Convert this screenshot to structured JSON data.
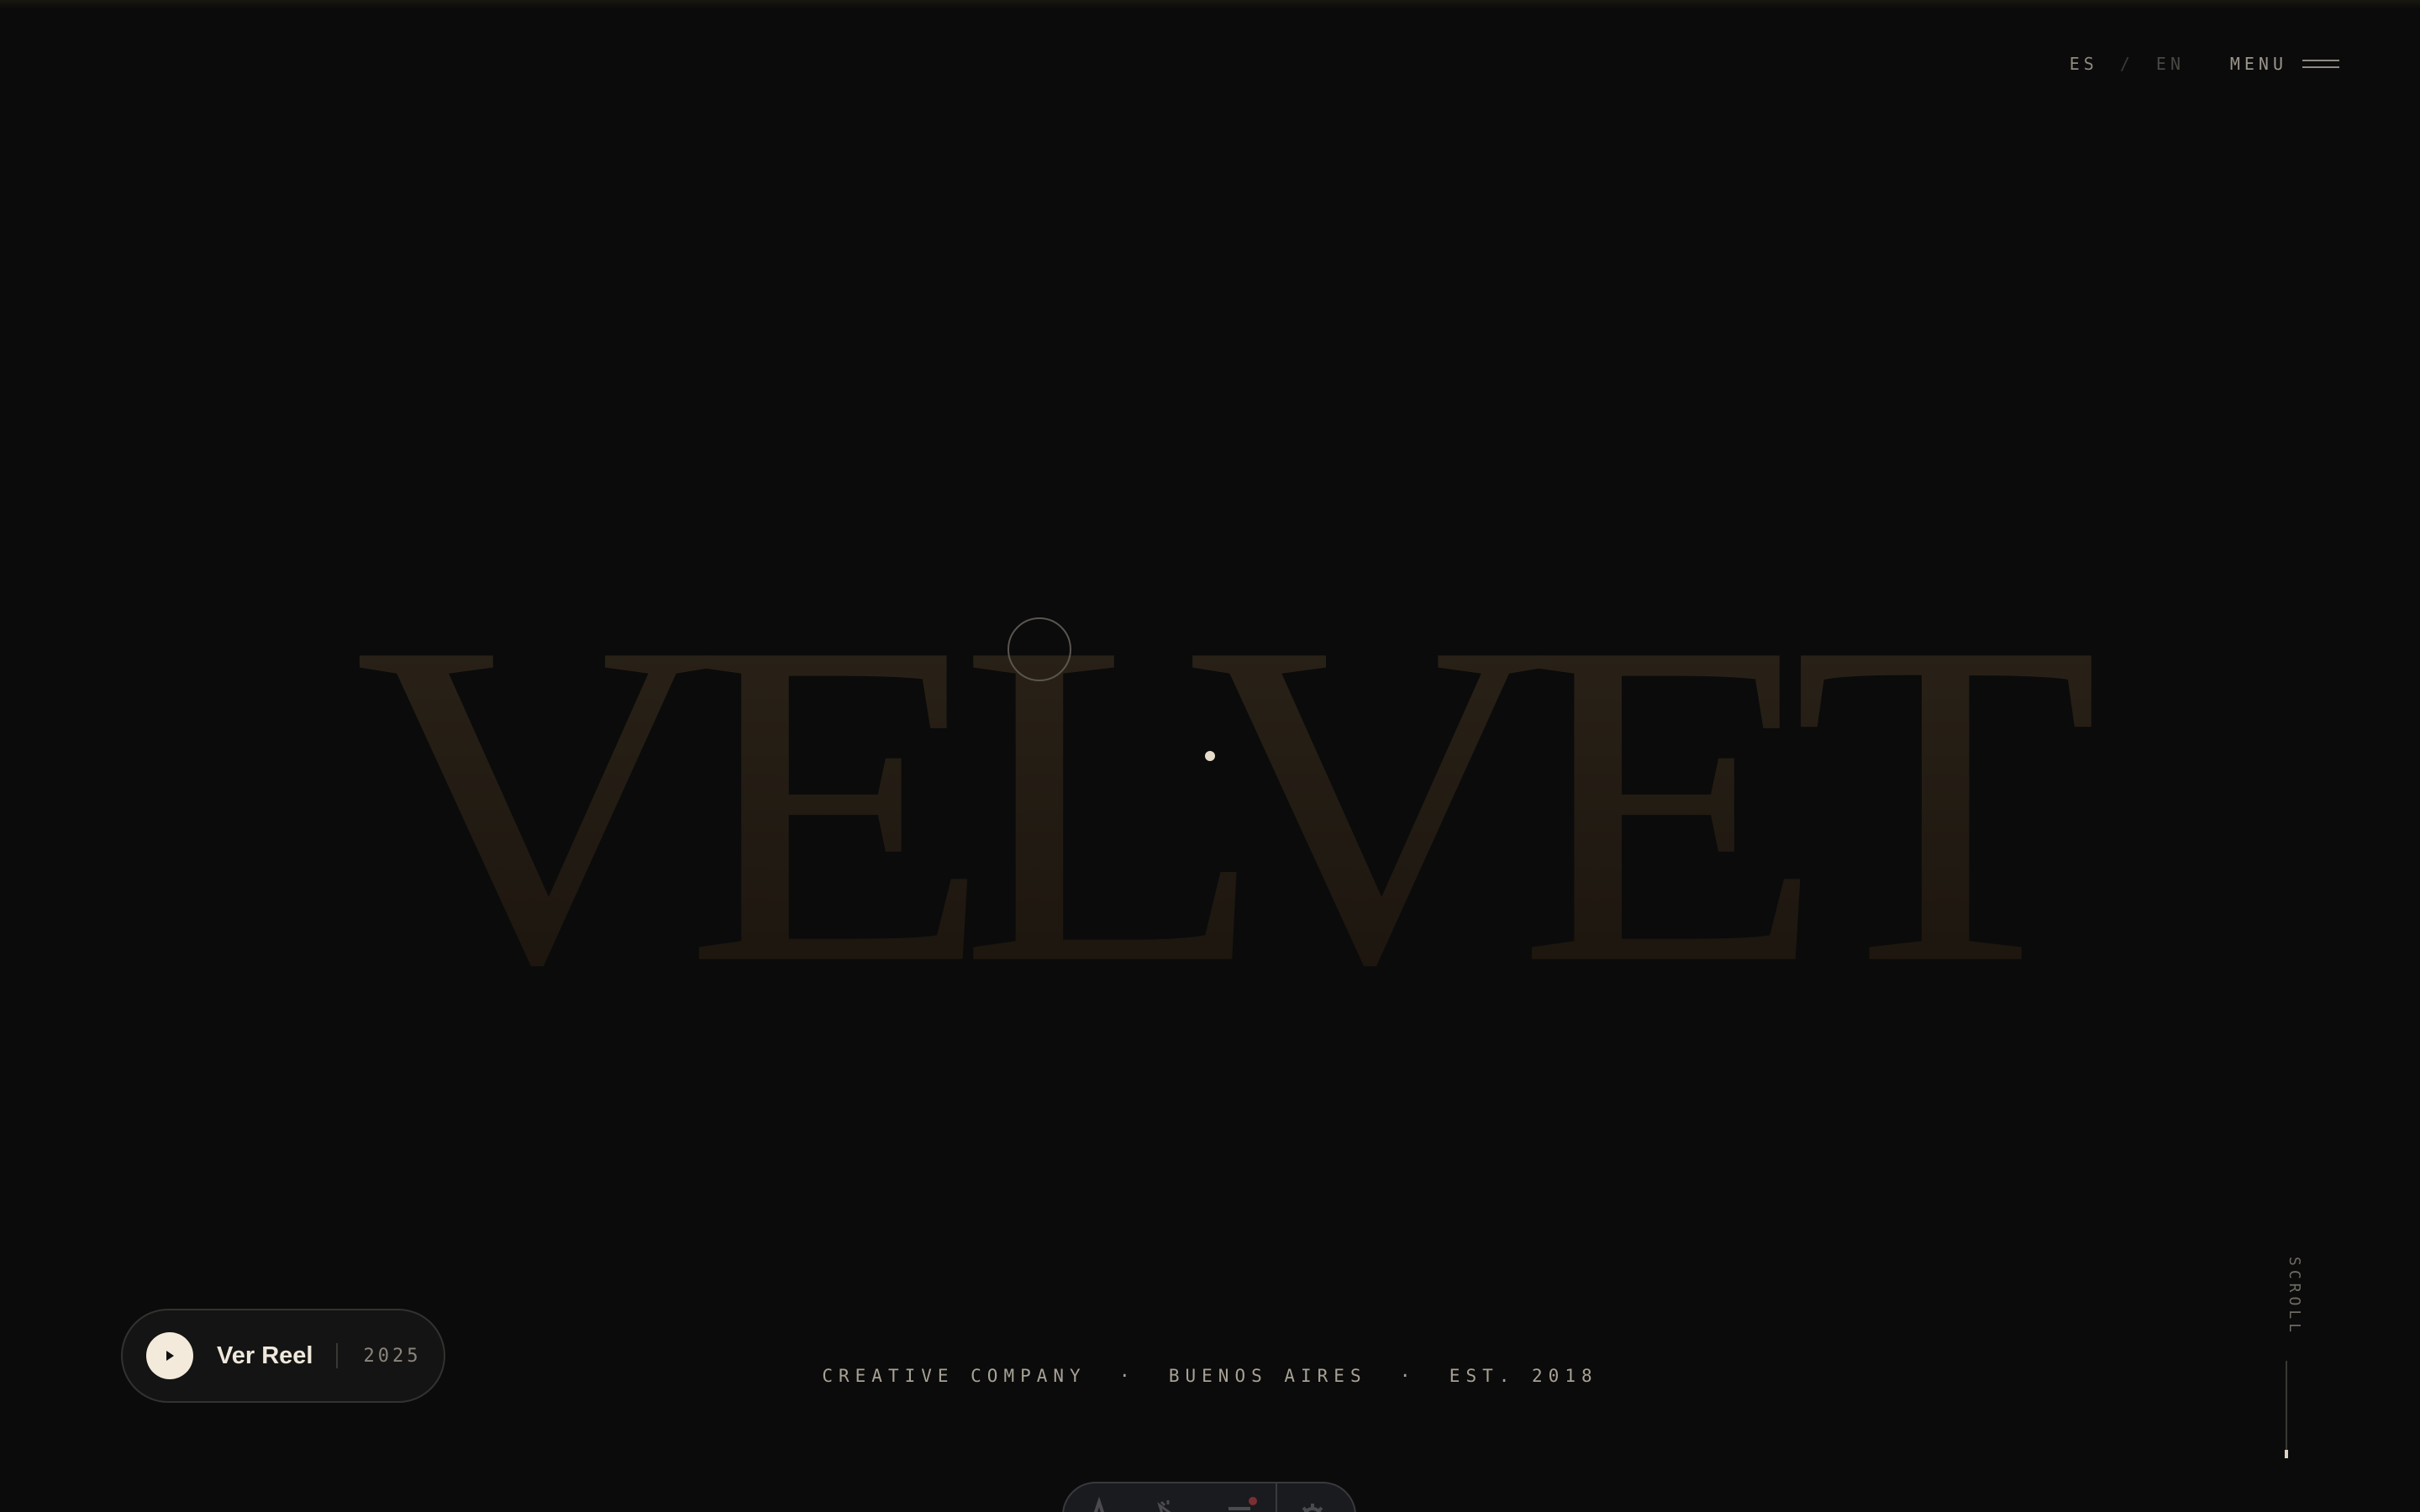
{
  "nav": {
    "lang_es": "ES",
    "lang_separator": "/",
    "lang_en": "EN",
    "menu_label": "MENU",
    "active_language": "ES"
  },
  "hero": {
    "wordmark": "VELVET"
  },
  "reel": {
    "label": "Ver Reel",
    "year": "2025",
    "icon": "play-icon"
  },
  "tagline": {
    "text": "CREATIVE COMPANY  ·  BUENOS AIRES  ·  EST. 2018"
  },
  "scroll": {
    "label": "SCROLL"
  },
  "toolbar": {
    "icons": [
      "text-tool-icon",
      "cursor-edit-icon",
      "layers-icon",
      "settings-icon"
    ]
  },
  "colors": {
    "background": "#0b0b0b",
    "wordmark": "#211a12",
    "accent_cream": "#f3eadb",
    "notification_dot": "#7a2f35"
  }
}
